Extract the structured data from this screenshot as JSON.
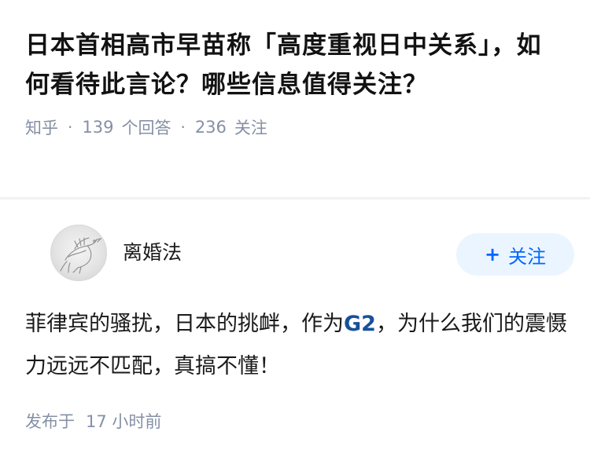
{
  "question": {
    "title": "日本首相高市早苗称「高度重视日中关系」，如何看待此言论？哪些信息值得关注？",
    "source": "知乎",
    "separator": "·",
    "answer_count": "139",
    "answer_count_label": "个回答",
    "follower_count": "236",
    "follower_count_label": "关注"
  },
  "answer": {
    "author_name": "离婚法",
    "follow_button": {
      "icon": "plus-icon",
      "plus_glyph": "+",
      "label": "关注"
    },
    "content_before": "菲律宾的骚扰，日本的挑衅，作为",
    "content_link": "G2",
    "content_after": "，为什么我们的震慑力远远不匹配，真搞不懂！",
    "time_label": "发布于",
    "time_value": "17 小时前"
  },
  "colors": {
    "meta_gray": "#8590a6",
    "follow_bg": "#ebf5ff",
    "follow_text": "#0066ff",
    "link_blue": "#175199",
    "divider": "#f0f2f6"
  }
}
